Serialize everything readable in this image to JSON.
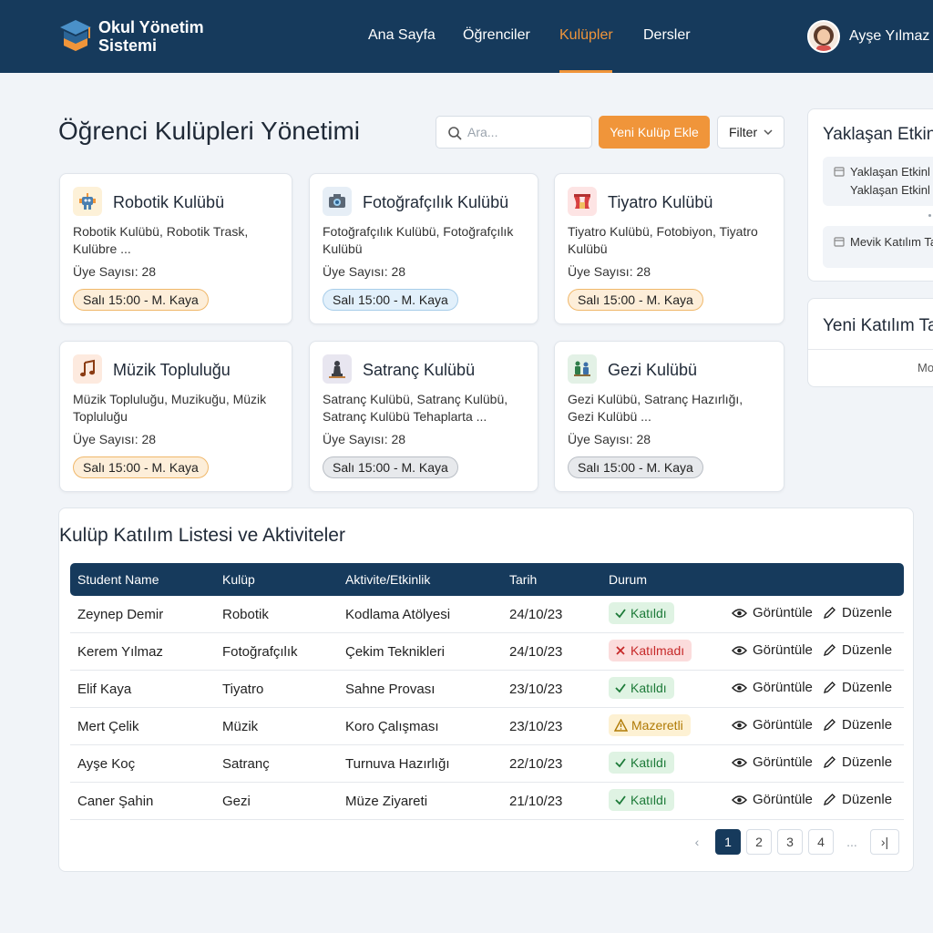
{
  "header": {
    "brand_line1": "Okul Yönetim",
    "brand_line2": "Sistemi",
    "nav": [
      {
        "label": "Ana Sayfa"
      },
      {
        "label": "Öğrenciler"
      },
      {
        "label": "Kulüpler"
      },
      {
        "label": "Dersler"
      }
    ],
    "active_nav": "Kulüpler",
    "user_name": "Ayşe Yılmaz"
  },
  "page": {
    "title": "Öğrenci Kulüpleri Yönetimi",
    "search_placeholder": "Ara...",
    "add_button": "Yeni Kulüp Ekle",
    "filter_button": "Filter"
  },
  "clubs": [
    {
      "name": "Robotik Kulübü",
      "desc": "Robotik Kulübü, Robotik Trask, Kulübre ...",
      "members": "Üye Sayısı: 28",
      "schedule": "Salı 15:00 - M. Kaya",
      "icon": "robot-icon",
      "tag": "orange"
    },
    {
      "name": "Fotoğrafçılık Kulübü",
      "desc": "Fotoğrafçılık Kulübü, Fotoğrafçılık Kulübü",
      "members": "Üye Sayısı: 28",
      "schedule": "Salı 15:00 - M. Kaya",
      "icon": "camera-icon",
      "tag": "blue"
    },
    {
      "name": "Tiyatro Kulübü",
      "desc": "Tiyatro Kulübü, Fotobiyon, Tiyatro Kulübü",
      "members": "Üye Sayısı: 28",
      "schedule": "Salı 15:00 - M. Kaya",
      "icon": "theater-icon",
      "tag": "orange"
    },
    {
      "name": "Müzik Topluluğu",
      "desc": "Müzik Topluluğu, Muzikuğu, Müzik Topluluğu",
      "members": "Üye Sayısı: 28",
      "schedule": "Salı 15:00 - M. Kaya",
      "icon": "music-note-icon",
      "tag": "orange"
    },
    {
      "name": "Satranç Kulübü",
      "desc": "Satranç Kulübü, Satranç Kulübü, Satranç Kulübü Tehaplarta ...",
      "members": "Üye Sayısı: 28",
      "schedule": "Salı 15:00 - M. Kaya",
      "icon": "chess-icon",
      "tag": "gray"
    },
    {
      "name": "Gezi Kulübü",
      "desc": "Gezi Kulübü, Satranç Hazırlığı, Gezi Kulübü ...",
      "members": "Üye Sayısı: 28",
      "schedule": "Salı 15:00 - M. Kaya",
      "icon": "travel-icon",
      "tag": "gray"
    }
  ],
  "side": {
    "events_title": "Yaklaşan Etkinl",
    "event1_line1": "Yaklaşan Etkinl",
    "event1_line2": "Yaklaşan Etkinl",
    "event2": "Mevik Katılım Ta",
    "requests_title": "Yeni Katılım Ta",
    "requests_more": "Mo"
  },
  "table": {
    "title": "Kulüp Katılım Listesi ve Aktiviteler",
    "headers": [
      "Student Name",
      "Kulüp",
      "Aktivite/Etkinlik",
      "Tarih",
      "Durum"
    ],
    "view_label": "Görüntüle",
    "edit_label": "Düzenle",
    "rows": [
      {
        "name": "Zeynep Demir",
        "club": "Robotik",
        "activity": "Kodlama Atölyesi",
        "date": "24/10/23",
        "status": "Katıldı",
        "kind": "green"
      },
      {
        "name": "Kerem Yılmaz",
        "club": "Fotoğrafçılık",
        "activity": "Çekim Teknikleri",
        "date": "24/10/23",
        "status": "Katılmadı",
        "kind": "red"
      },
      {
        "name": "Elif Kaya",
        "club": "Tiyatro",
        "activity": "Sahne Provası",
        "date": "23/10/23",
        "status": "Katıldı",
        "kind": "green"
      },
      {
        "name": "Mert Çelik",
        "club": "Müzik",
        "activity": "Koro Çalışması",
        "date": "23/10/23",
        "status": "Mazeretli",
        "kind": "yellow"
      },
      {
        "name": "Ayşe Koç",
        "club": "Satranç",
        "activity": "Turnuva Hazırlığı",
        "date": "22/10/23",
        "status": "Katıldı",
        "kind": "green"
      },
      {
        "name": "Caner Şahin",
        "club": "Gezi",
        "activity": "Müze Ziyareti",
        "date": "21/10/23",
        "status": "Katıldı",
        "kind": "green"
      }
    ],
    "pages": [
      "1",
      "2",
      "3",
      "4"
    ],
    "ellipsis": "...",
    "prev": "‹",
    "last": "›|"
  },
  "colors": {
    "primary": "#163a5c",
    "accent": "#f0953a",
    "background": "#f1f4f8"
  }
}
